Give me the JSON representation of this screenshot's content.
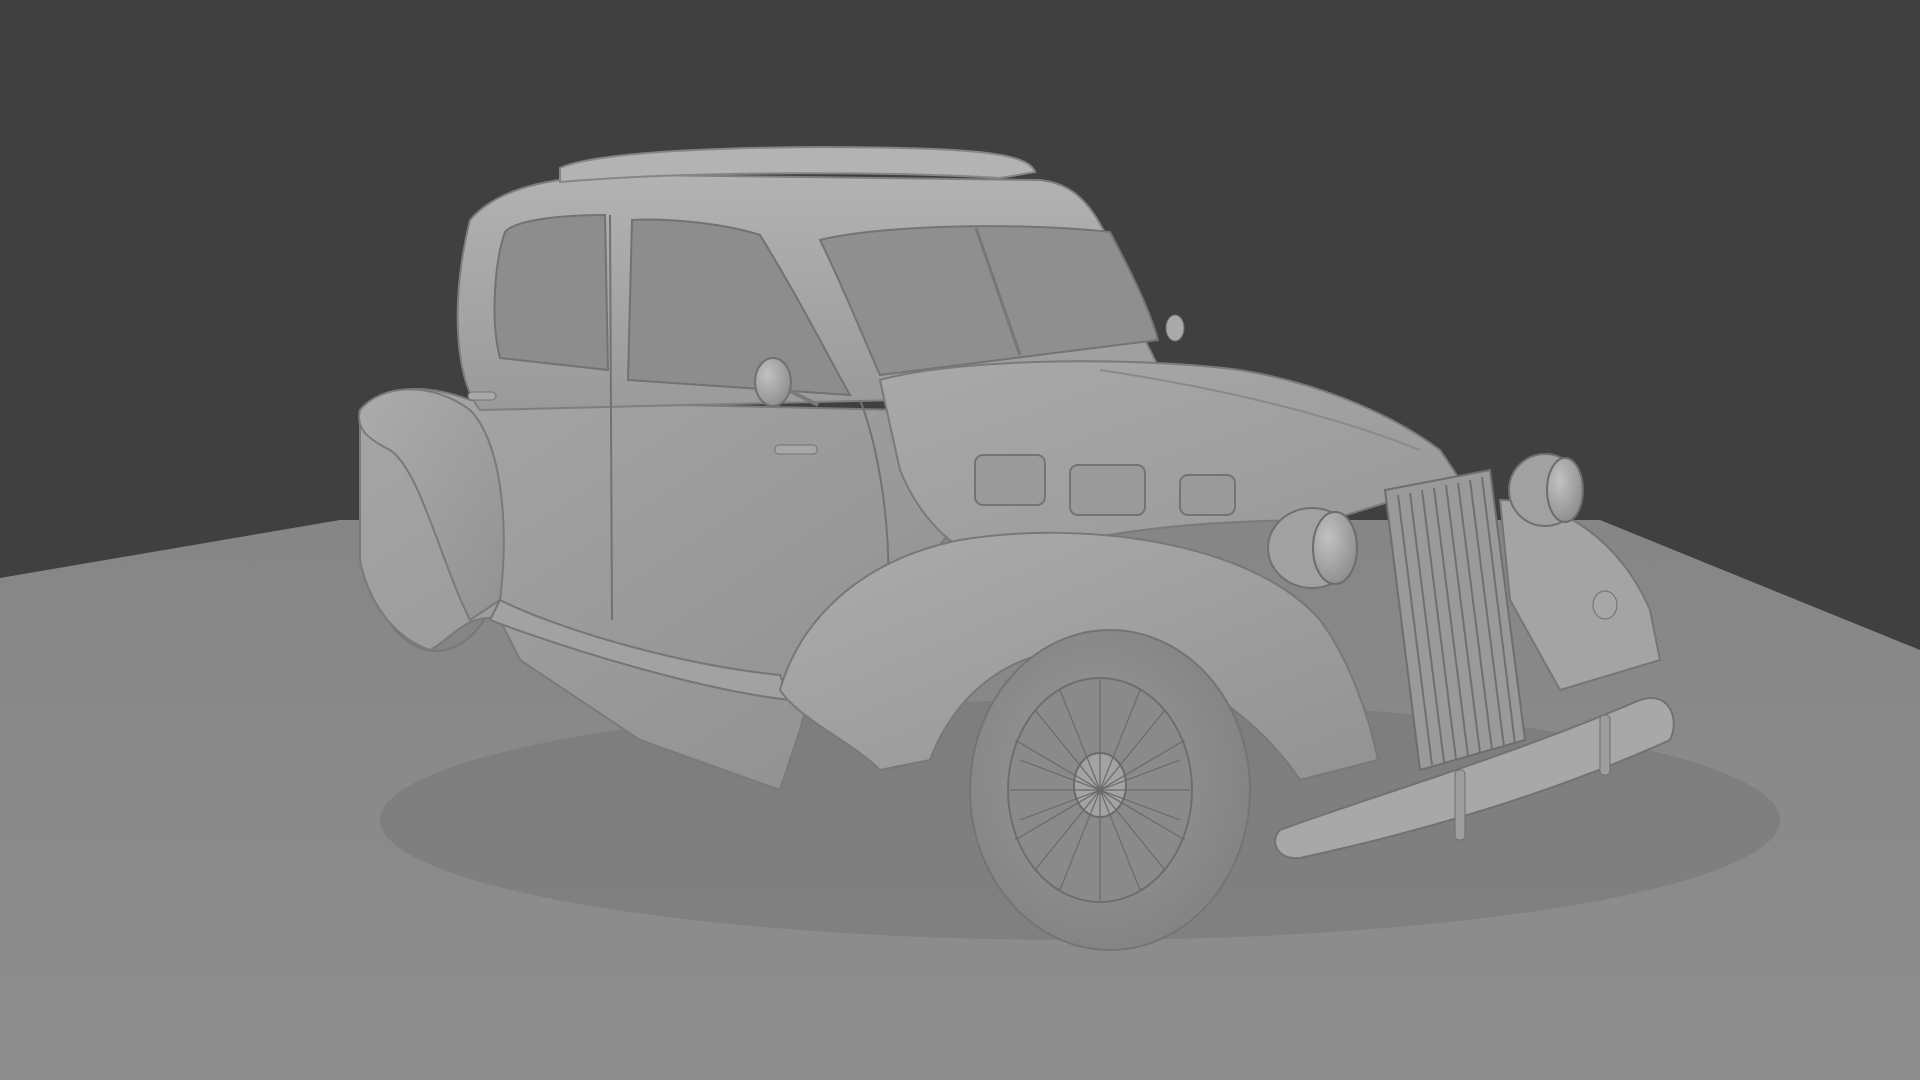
{
  "scene": {
    "subject": "car",
    "style": "clay-render",
    "colors": {
      "background": "#404040",
      "floor": "#8a8a8a",
      "body": "#9c9c9c",
      "body_light": "#b1b1b1",
      "body_dark": "#7e7e7e",
      "glass": "#8c8c8c",
      "shadow": "#5f5f5f",
      "line": "#6e6e6e"
    }
  }
}
